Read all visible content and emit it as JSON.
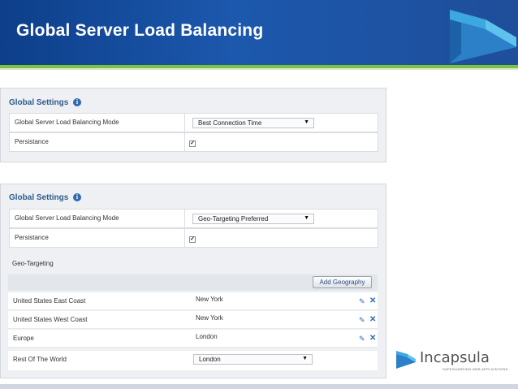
{
  "slide": {
    "title": "Global Server Load Balancing"
  },
  "panel1": {
    "title": "Global Settings",
    "rows": [
      {
        "label": "Global Server Load Balancing Mode",
        "value": "Best Connection Time"
      },
      {
        "label": "Persistance",
        "checked": true
      }
    ]
  },
  "panel2": {
    "title": "Global Settings",
    "rows": [
      {
        "label": "Global Server Load Balancing Mode",
        "value": "Geo-Targeting Preferred"
      },
      {
        "label": "Persistance",
        "checked": true
      }
    ],
    "geo_targeting_label": "Geo-Targeting",
    "add_button": "Add Geography",
    "geo_rows": [
      {
        "region": "United States East Coast",
        "city": "New York"
      },
      {
        "region": "United States West Coast",
        "city": "New York"
      },
      {
        "region": "Europe",
        "city": "London"
      },
      {
        "region": "Rest Of The World",
        "city": "London"
      }
    ]
  },
  "brand": {
    "name": "Incapsula",
    "tagline": "SAFEGUARDING WEB APPLICATIONS",
    "accent": "#2f6bb0",
    "banner_color": "#1c58ad",
    "stripe_color": "#7cc242"
  },
  "icons": {
    "info": "info-icon",
    "edit": "pencil-icon",
    "delete": "x-icon",
    "dropdown": "triangle-down-icon"
  }
}
